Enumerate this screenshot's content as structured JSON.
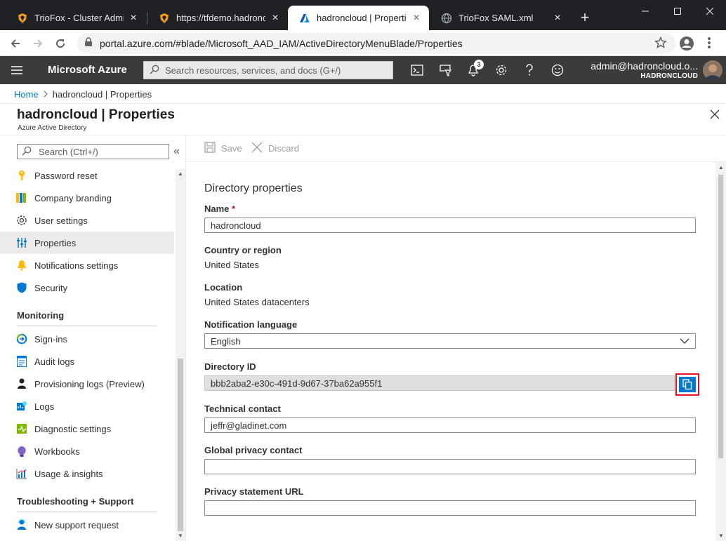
{
  "browser": {
    "tabs": [
      {
        "title": "TrioFox - Cluster Admin (t",
        "active": false
      },
      {
        "title": "https://tfdemo.hadronclo",
        "active": false
      },
      {
        "title": "hadroncloud | Properties",
        "active": true
      },
      {
        "title": "TrioFox SAML.xml",
        "active": false
      }
    ],
    "url": "portal.azure.com/#blade/Microsoft_AAD_IAM/ActiveDirectoryMenuBlade/Properties"
  },
  "azure": {
    "brand": "Microsoft Azure",
    "search_placeholder": "Search resources, services, and docs (G+/)",
    "notification_count": "3",
    "account_email": "admin@hadroncloud.o...",
    "account_tenant": "HADRONCLOUD"
  },
  "breadcrumb": {
    "home": "Home",
    "current": "hadroncloud | Properties"
  },
  "blade": {
    "title": "hadroncloud | Properties",
    "subtitle": "Azure Active Directory"
  },
  "menu": {
    "search_placeholder": "Search (Ctrl+/)",
    "items": [
      {
        "label": "Password reset",
        "icon": "key-icon"
      },
      {
        "label": "Company branding",
        "icon": "branding-icon"
      },
      {
        "label": "User settings",
        "icon": "gear-icon"
      },
      {
        "label": "Properties",
        "icon": "properties-icon",
        "selected": true
      },
      {
        "label": "Notifications settings",
        "icon": "bell-icon"
      },
      {
        "label": "Security",
        "icon": "shield-icon"
      }
    ],
    "monitoring_header": "Monitoring",
    "monitoring_items": [
      {
        "label": "Sign-ins",
        "icon": "signin-icon"
      },
      {
        "label": "Audit logs",
        "icon": "audit-log-icon"
      },
      {
        "label": "Provisioning logs (Preview)",
        "icon": "provisioning-icon"
      },
      {
        "label": "Logs",
        "icon": "logs-icon"
      },
      {
        "label": "Diagnostic settings",
        "icon": "diagnostic-icon"
      },
      {
        "label": "Workbooks",
        "icon": "workbook-icon"
      },
      {
        "label": "Usage & insights",
        "icon": "insights-icon"
      }
    ],
    "troubleshooting_header": "Troubleshooting + Support",
    "troubleshooting_items": [
      {
        "label": "New support request",
        "icon": "support-icon"
      }
    ]
  },
  "commands": {
    "save": "Save",
    "discard": "Discard"
  },
  "form": {
    "section_title": "Directory properties",
    "name_label": "Name",
    "name_required": "*",
    "name_value": "hadroncloud",
    "country_label": "Country or region",
    "country_value": "United States",
    "location_label": "Location",
    "location_value": "United States datacenters",
    "language_label": "Notification language",
    "language_value": "English",
    "directory_id_label": "Directory ID",
    "directory_id_value": "bbb2aba2-e30c-491d-9d67-37ba62a955f1",
    "technical_contact_label": "Technical contact",
    "technical_contact_value": "jeffr@gladinet.com",
    "global_privacy_label": "Global privacy contact",
    "global_privacy_value": "",
    "privacy_url_label": "Privacy statement URL",
    "privacy_url_value": ""
  },
  "colors": {
    "azure_blue": "#0078d4",
    "highlight_red": "#e81123",
    "topbar": "#3b3b3b"
  }
}
